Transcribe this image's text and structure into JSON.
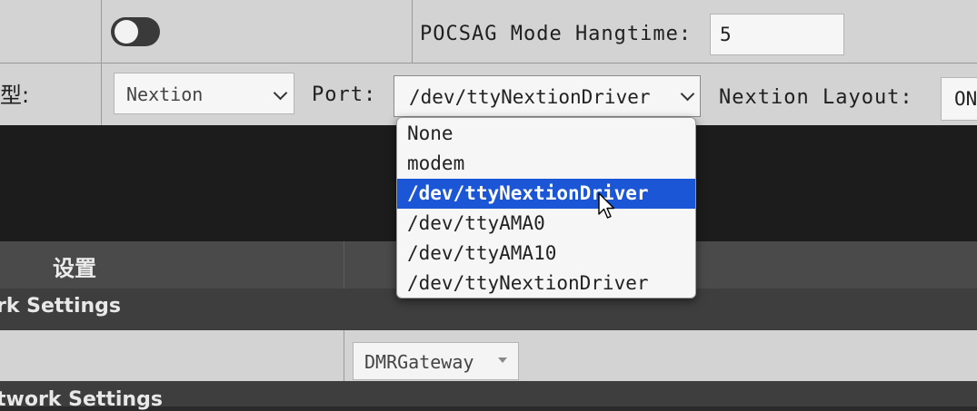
{
  "row1": {
    "hangtime_label": "POCSAG Mode Hangtime:",
    "hangtime_value": "5"
  },
  "row2": {
    "type_label": "型:",
    "display_select_value": "Nextion",
    "port_label": "Port:",
    "port_select_value": "/dev/ttyNextionDriver",
    "layout_label": "Nextion Layout:",
    "layout_value": "ON"
  },
  "port_dropdown": {
    "options": [
      "None",
      "modem",
      "/dev/ttyNextionDriver",
      "/dev/ttyAMA0",
      "/dev/ttyAMA10",
      "/dev/ttyNextionDriver"
    ],
    "selected_index": 2
  },
  "section": {
    "title": "设置"
  },
  "network": {
    "title1": "rk Settings",
    "mode_select_value": "DMRGateway",
    "title2": "twork Settings"
  },
  "colors": {
    "selected_bg": "#1a56d6",
    "panel_bg": "#d3d3d3",
    "dark_bg": "#1c1c1c"
  }
}
